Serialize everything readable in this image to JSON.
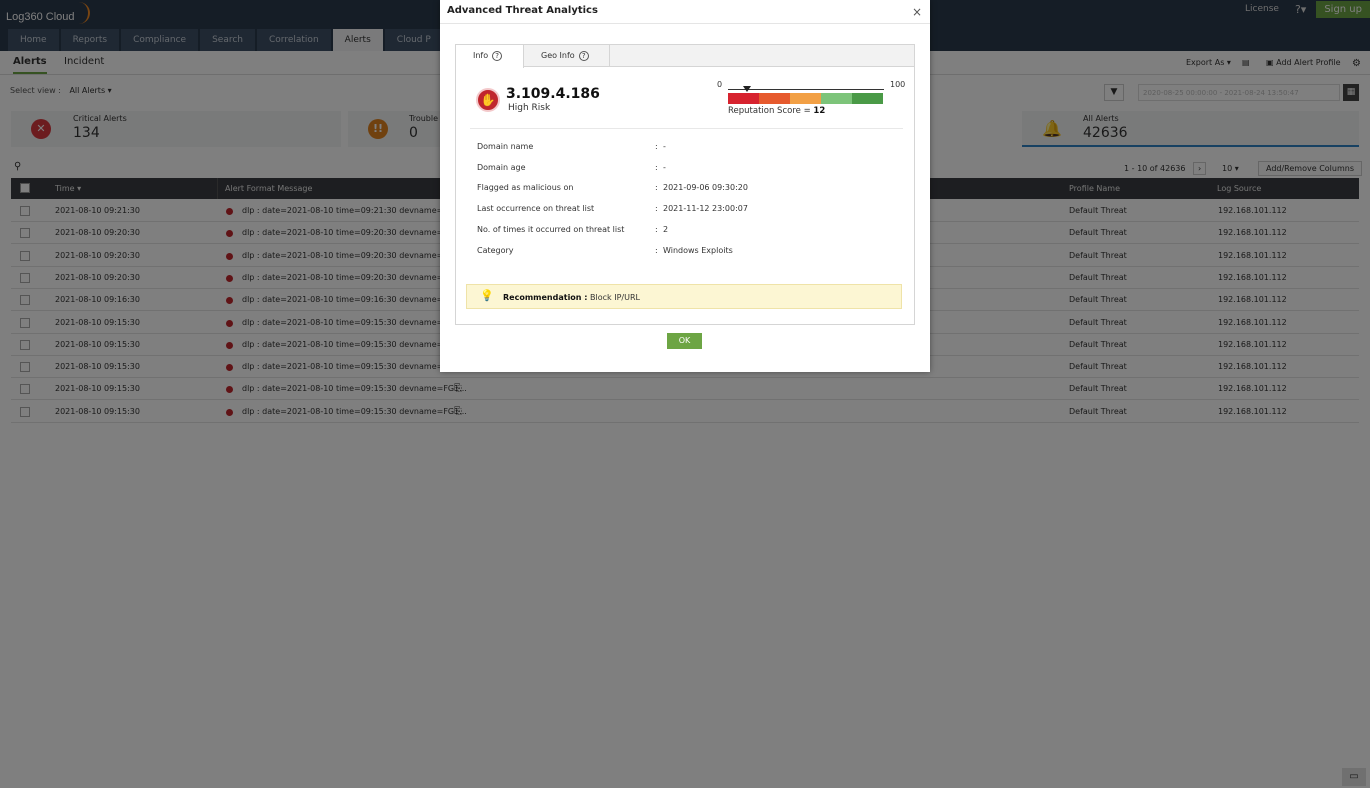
{
  "app": {
    "logo": "Log360 Cloud",
    "license": "License",
    "help": "?",
    "signup": "Sign up"
  },
  "nav": [
    "Home",
    "Reports",
    "Compliance",
    "Search",
    "Correlation",
    "Alerts",
    "Cloud P"
  ],
  "subtabs": [
    "Alerts",
    "Incident"
  ],
  "select_view": {
    "label": "Select view :",
    "value": "All Alerts"
  },
  "toolbar": {
    "export": "Export As",
    "add_profile": "Add Alert Profile"
  },
  "cards": [
    {
      "label": "Critical Alerts",
      "value": "134",
      "color": "#d9383f",
      "icon": "close-icon"
    },
    {
      "label": "Trouble",
      "value": "0",
      "color": "#e0831f",
      "icon": "warning-icon"
    },
    {
      "label": "All Alerts",
      "value": "42636",
      "color": "#2f82c4",
      "icon": "bell-icon"
    }
  ],
  "date_range": "2020-08-25 00:00:00 - 2021-08-24 13:50:47",
  "pager": {
    "range": "1 - 10 of 42636",
    "per_page": "10",
    "add_remove": "Add/Remove Columns"
  },
  "table": {
    "headers": {
      "time": "Time",
      "message": "Alert Format Message",
      "profile": "Profile Name",
      "source": "Log Source"
    },
    "rows": [
      {
        "time": "2021-08-10 09:21:30",
        "message": "dlp : date=2021-08-10 time=09:21:30 devname=FG1...",
        "profile": "Default Threat",
        "source": "192.168.101.112"
      },
      {
        "time": "2021-08-10 09:20:30",
        "message": "dlp : date=2021-08-10 time=09:20:30 devname=FG1...",
        "profile": "Default Threat",
        "source": "192.168.101.112"
      },
      {
        "time": "2021-08-10 09:20:30",
        "message": "dlp : date=2021-08-10 time=09:20:30 devname=FG1...",
        "profile": "Default Threat",
        "source": "192.168.101.112"
      },
      {
        "time": "2021-08-10 09:20:30",
        "message": "dlp : date=2021-08-10 time=09:20:30 devname=FG1...",
        "profile": "Default Threat",
        "source": "192.168.101.112"
      },
      {
        "time": "2021-08-10 09:16:30",
        "message": "dlp : date=2021-08-10 time=09:16:30 devname=FG1...",
        "profile": "Default Threat",
        "source": "192.168.101.112"
      },
      {
        "time": "2021-08-10 09:15:30",
        "message": "dlp : date=2021-08-10 time=09:15:30 devname=FG1...",
        "profile": "Default Threat",
        "source": "192.168.101.112"
      },
      {
        "time": "2021-08-10 09:15:30",
        "message": "dlp : date=2021-08-10 time=09:15:30 devname=FG1...",
        "profile": "Default Threat",
        "source": "192.168.101.112"
      },
      {
        "time": "2021-08-10 09:15:30",
        "message": "dlp : date=2021-08-10 time=09:15:30 devname=FG1...",
        "profile": "Default Threat",
        "source": "192.168.101.112"
      },
      {
        "time": "2021-08-10 09:15:30",
        "message": "dlp : date=2021-08-10 time=09:15:30 devname=FG1...",
        "profile": "Default Threat",
        "source": "192.168.101.112"
      },
      {
        "time": "2021-08-10 09:15:30",
        "message": "dlp : date=2021-08-10 time=09:15:30 devname=FG1...",
        "profile": "Default Threat",
        "source": "192.168.101.112"
      }
    ]
  },
  "modal": {
    "title": "Advanced Threat Analytics",
    "close": "×",
    "tabs": [
      "Info",
      "Geo Info"
    ],
    "ip": "3.109.4.186",
    "risk": "High Risk",
    "reputation": {
      "min": "0",
      "max": "100",
      "label": "Reputation Score =",
      "score": "12",
      "score_value": 12,
      "colors": [
        "#d7232f",
        "#e65a2e",
        "#f2a045",
        "#7dc47a",
        "#4a9a47"
      ]
    },
    "details": [
      {
        "label": "Domain name",
        "value": "-"
      },
      {
        "label": "Domain age",
        "value": "-"
      },
      {
        "label": "Flagged as malicious on",
        "value": "2021-09-06 09:30:20"
      },
      {
        "label": "Last occurrence on threat list",
        "value": "2021-11-12 23:00:07"
      },
      {
        "label": "No. of times it occurred on threat list",
        "value": "2"
      },
      {
        "label": "Category",
        "value": "Windows Exploits"
      }
    ],
    "recommendation": {
      "label": "Recommendation :",
      "value": "Block IP/URL"
    },
    "ok": "OK"
  }
}
